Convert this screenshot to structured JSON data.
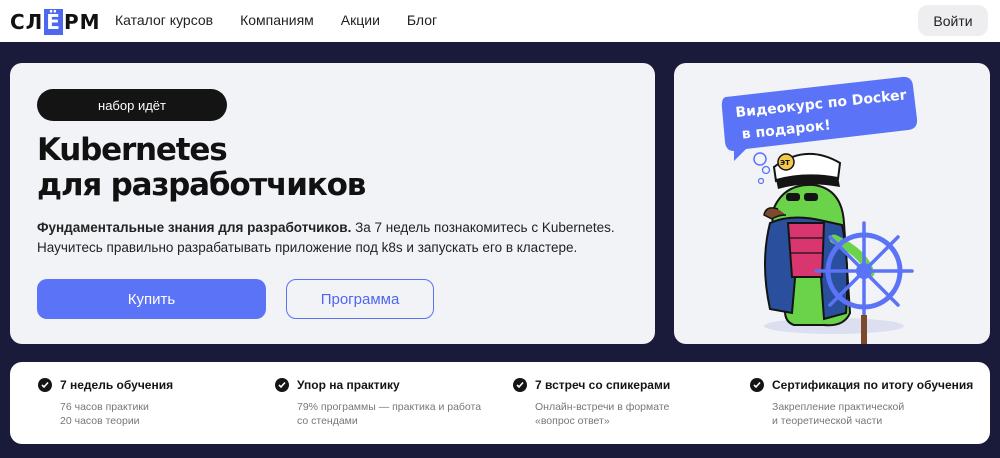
{
  "header": {
    "logo": {
      "left": "СЛ",
      "mid": "Ё",
      "right": "РМ"
    },
    "nav": [
      "Каталог курсов",
      "Компаниям",
      "Акции",
      "Блог"
    ],
    "login_label": "Войти"
  },
  "hero": {
    "badge": "набор идёт",
    "title_line1": "Kubernetes",
    "title_line2": "для разработчиков",
    "desc_bold": "Фундаментальные знания для разработчиков.",
    "desc_rest": " За 7 недель познакомитесь с Kubernetes.",
    "desc_line2": "Научитесь правильно разрабатывать приложение под k8s и запускать его в кластере.",
    "buy_label": "Купить",
    "program_label": "Программа"
  },
  "promo": {
    "bubble_line1": "Видеокурс по Docker",
    "bubble_line2": "в подарок!",
    "cap_badge": "ЭТ"
  },
  "features": [
    {
      "title": "7 недель обучения",
      "sub1": "76 часов практики",
      "sub2": "20 часов теории"
    },
    {
      "title": "Упор на практику",
      "sub1": "79% программы — практика и работа",
      "sub2": "со стендами"
    },
    {
      "title": "7 встреч со спикерами",
      "sub1": "Онлайн-встречи в формате",
      "sub2": "«вопрос ответ»"
    },
    {
      "title": "Сертификация по итогу обучения",
      "sub1": "Закрепление практической",
      "sub2": "и теоретической части"
    }
  ],
  "colors": {
    "accent": "#5a73f7",
    "dark": "#141414",
    "bg": "#1a1b3a",
    "card": "#f2f3f7"
  }
}
